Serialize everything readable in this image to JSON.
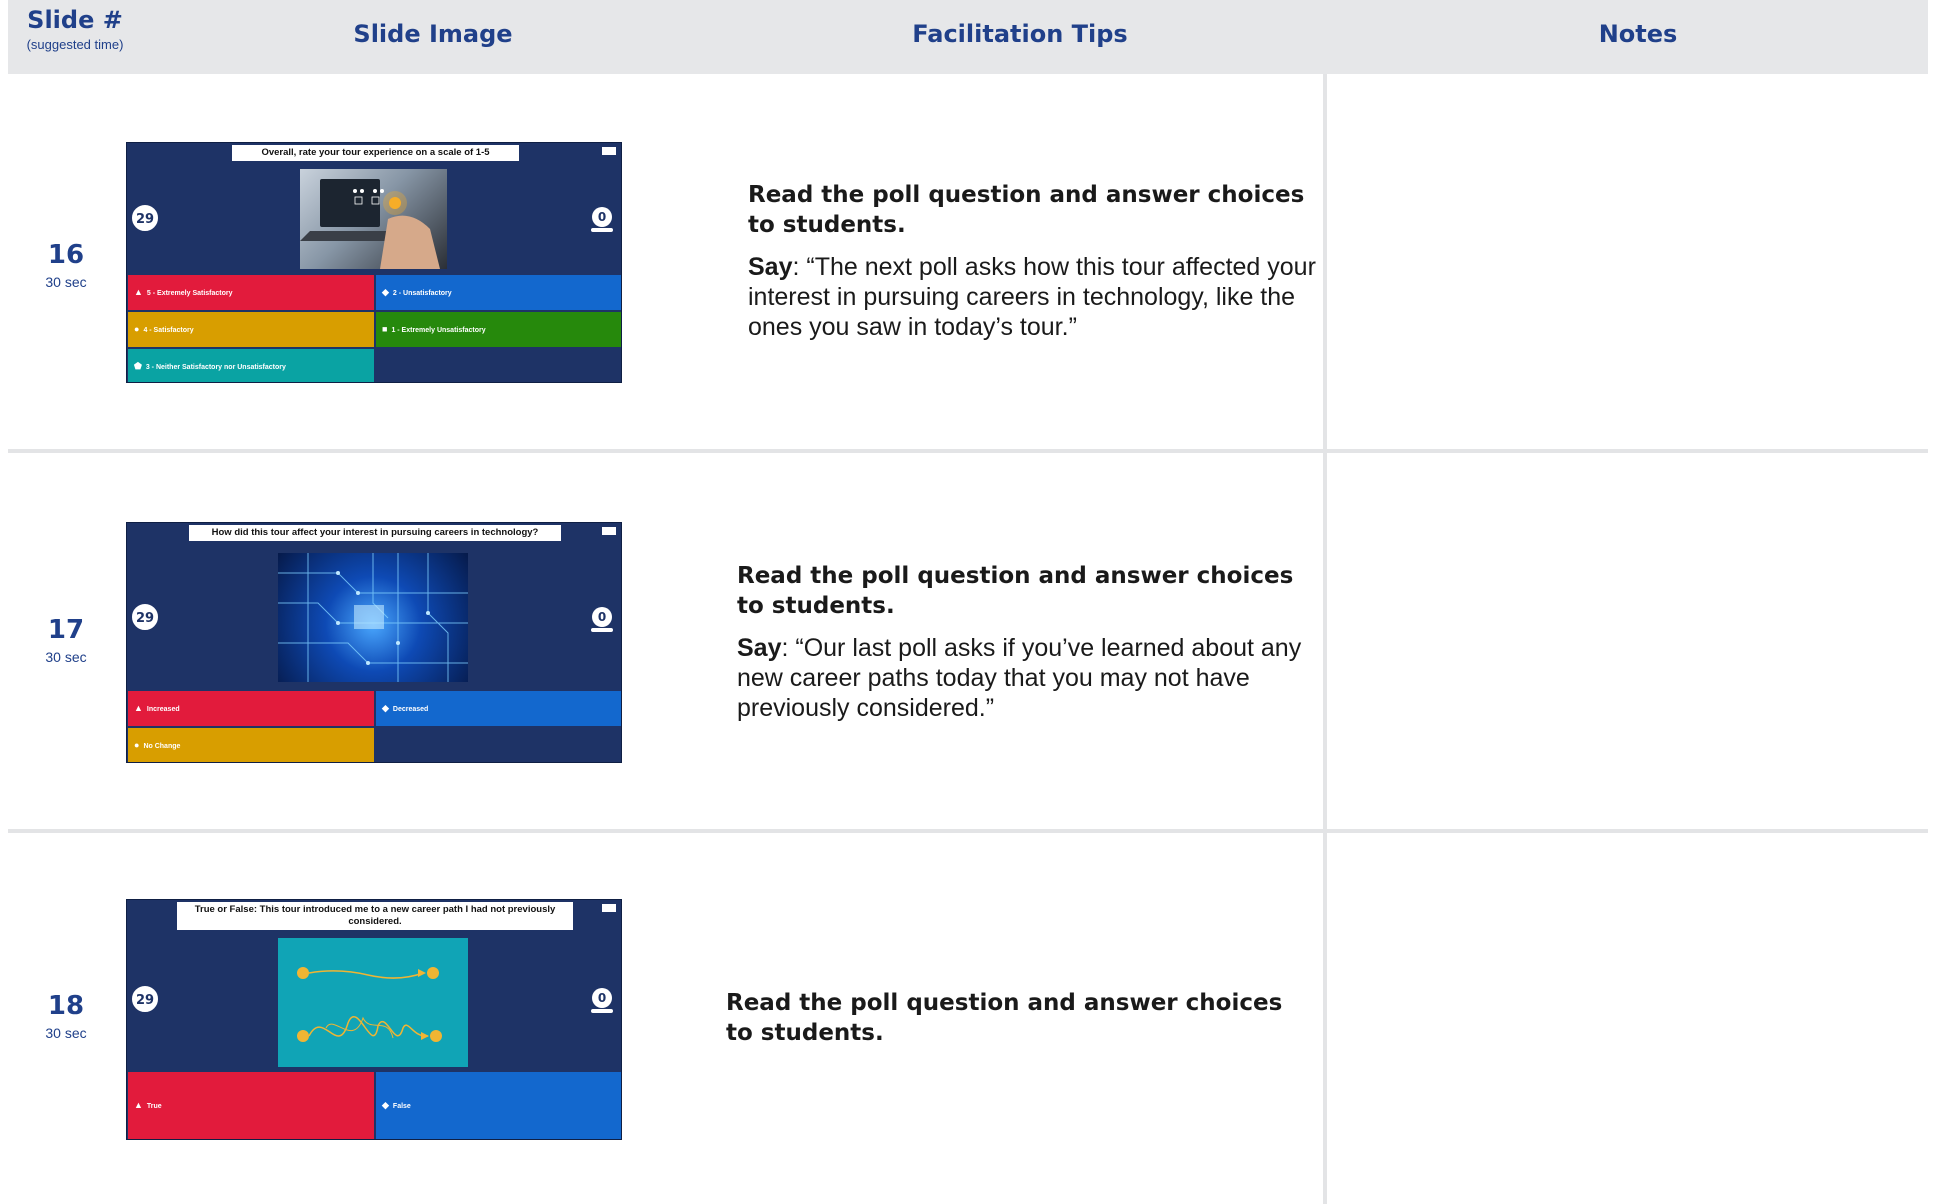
{
  "header": {
    "slide_label": "Slide #",
    "slide_sub": "(suggested time)",
    "col_image": "Slide Image",
    "col_tips": "Facilitation Tips",
    "col_notes": "Notes"
  },
  "rows": [
    {
      "number": "16",
      "time": "30 sec",
      "slide": {
        "question_pre": "Overall, rate your ",
        "question_bold": "tour experience",
        "question_post": " on a scale of 1-5",
        "timer": "29",
        "answers": "0",
        "image_icon": "laptop-rating-photo",
        "options": [
          {
            "label": "5 - Extremely Satisfactory",
            "color": "#e21b3c",
            "icon": "triangle"
          },
          {
            "label": "2 - Unsatisfactory",
            "color": "#1368ce",
            "icon": "diamond"
          },
          {
            "label": "4 - Satisfactory",
            "color": "#d89e00",
            "icon": "circle"
          },
          {
            "label": "1 - Extremely Unsatisfactory",
            "color": "#26890c",
            "icon": "square"
          },
          {
            "label": "3 - Neither Satisfactory nor Unsatisfactory",
            "color": "#0aa3a3",
            "icon": "pentagon"
          }
        ]
      },
      "tips": {
        "heading": "Read the poll question and answer choices to students.",
        "say_label": "Say",
        "say_text": ": “The next poll asks how this tour affected your interest in pursuing careers in technology, like the ones you saw in today’s tour.”"
      }
    },
    {
      "number": "17",
      "time": "30 sec",
      "slide": {
        "question": "How did this tour affect your interest in pursuing careers in technology?",
        "timer": "29",
        "answers": "0",
        "image_icon": "circuit-board-photo",
        "options": [
          {
            "label": "Increased",
            "color": "#e21b3c",
            "icon": "triangle"
          },
          {
            "label": "Decreased",
            "color": "#1368ce",
            "icon": "diamond"
          },
          {
            "label": "No Change",
            "color": "#d89e00",
            "icon": "circle"
          }
        ]
      },
      "tips": {
        "heading": "Read the poll question and answer choices to students.",
        "say_label": "Say",
        "say_text": ": “Our last poll asks if you’ve learned about any new career paths today that you may not have previously considered.”"
      }
    },
    {
      "number": "18",
      "time": "30 sec",
      "slide": {
        "question_bold": "True or False:",
        "question_post": " This tour introduced me to a new career path I had not previously considered.",
        "timer": "29",
        "answers": "0",
        "image_icon": "straight-vs-tangled-path-illustration",
        "options": [
          {
            "label": "True",
            "color": "#e21b3c",
            "icon": "triangle"
          },
          {
            "label": "False",
            "color": "#1368ce",
            "icon": "diamond"
          }
        ]
      },
      "tips": {
        "heading": "Read the poll question and answer choices to students."
      }
    }
  ]
}
